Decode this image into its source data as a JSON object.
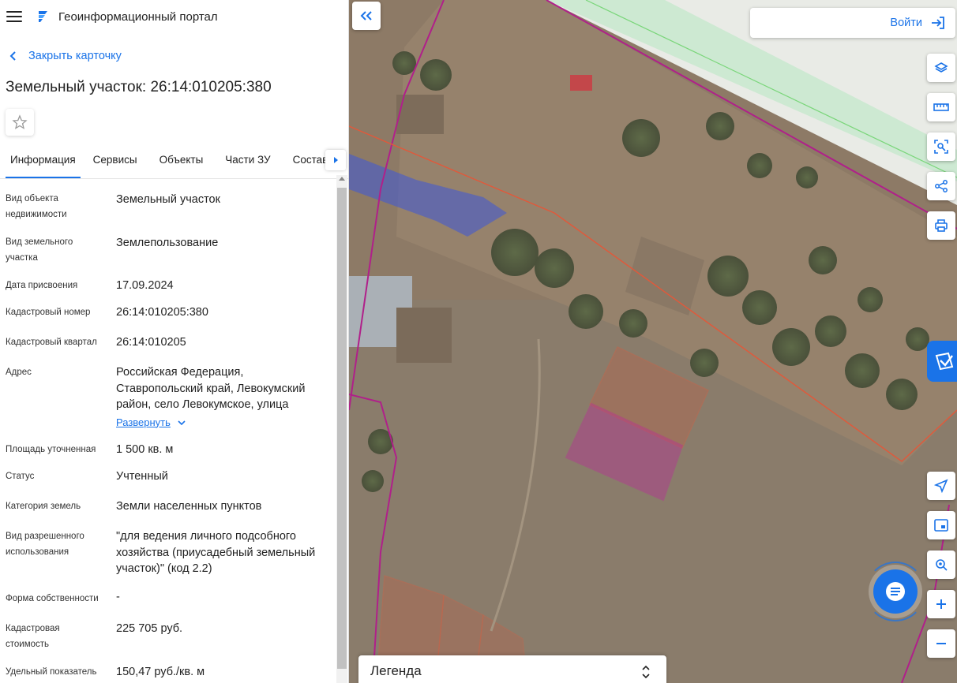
{
  "app": {
    "title": "Геоинформационный портал"
  },
  "card": {
    "back_label": "Закрыть карточку",
    "title": "Земельный участок: 26:14:010205:380"
  },
  "tabs": [
    "Информация",
    "Сервисы",
    "Объекты",
    "Части ЗУ",
    "Состав"
  ],
  "info": {
    "rows": [
      {
        "label": "Вид объекта недвижимости",
        "value": "Земельный участок"
      },
      {
        "label": "Вид земельного участка",
        "value": "Землепользование"
      },
      {
        "label": "Дата присвоения",
        "value": "17.09.2024"
      },
      {
        "label": "Кадастровый номер",
        "value": "26:14:010205:380"
      },
      {
        "label": "Кадастровый квартал",
        "value": "26:14:010205"
      },
      {
        "label": "Адрес",
        "value": "Российская Федерация, Ставропольский край, Левокумский район, село Левокумское, улица",
        "expand": "Развернуть"
      },
      {
        "label": "Площадь уточненная",
        "value": "1 500 кв. м"
      },
      {
        "label": "Статус",
        "value": "Учтенный"
      },
      {
        "label": "Категория земель",
        "value": "Земли населенных пунктов"
      },
      {
        "label": "Вид разрешенного использования",
        "value": "\"для ведения личного подсобного хозяйства (приусадебный земельный участок)\" (код 2.2)"
      },
      {
        "label": "Форма собственности",
        "value": "-"
      },
      {
        "label": "Кадастровая стоимость",
        "value": "225 705 руб."
      },
      {
        "label": "Удельный показатель",
        "value": "150,47 руб./кв. м"
      }
    ]
  },
  "map": {
    "login_label": "Войти",
    "legend_label": "Легенда",
    "tools": [
      "layers-icon",
      "ruler-icon",
      "select-area-icon",
      "share-icon",
      "print-icon",
      "locate-icon",
      "minimap-icon",
      "search-location-icon",
      "zoom-in-icon",
      "zoom-out-icon"
    ]
  },
  "colors": {
    "accent": "#1a73e8",
    "parcel_selected": "#c21fa0",
    "parcel_border": "#e2583a",
    "boundary": "#b0208a"
  }
}
